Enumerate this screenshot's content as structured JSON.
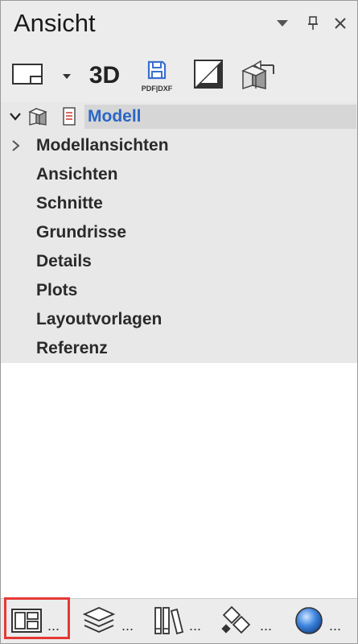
{
  "panel": {
    "title": "Ansicht"
  },
  "title_controls": {
    "dropdown_icon": "triangle-down-icon",
    "pin_icon": "pin-icon",
    "close_icon": "close-icon"
  },
  "toolbar": {
    "viewport_icon": "viewport-frame-icon",
    "viewport_dropdown_icon": "triangle-down-icon",
    "three_d_label": "3D",
    "pdf_caption": "PDF|DXF",
    "pdf_icon": "save-disk-icon",
    "elevation_icon": "diagonal-split-icon",
    "import_icon": "box-import-icon"
  },
  "tree": {
    "root": {
      "label": "Modell",
      "icons": [
        "cube-icon",
        "document-icon"
      ]
    },
    "items": [
      {
        "label": "Modellansichten",
        "expandable": true
      },
      {
        "label": "Ansichten",
        "expandable": false
      },
      {
        "label": "Schnitte",
        "expandable": false
      },
      {
        "label": "Grundrisse",
        "expandable": false
      },
      {
        "label": "Details",
        "expandable": false
      },
      {
        "label": "Plots",
        "expandable": false
      },
      {
        "label": "Layoutvorlagen",
        "expandable": false
      },
      {
        "label": "Referenz",
        "expandable": false
      }
    ]
  },
  "bottombar": {
    "items": [
      {
        "icon": "layout-panels-icon",
        "more": "..."
      },
      {
        "icon": "layers-icon",
        "more": "..."
      },
      {
        "icon": "library-books-icon",
        "more": "..."
      },
      {
        "icon": "tools-icon",
        "more": "..."
      },
      {
        "icon": "sphere-icon",
        "more": "..."
      }
    ]
  },
  "colors": {
    "accent": "#2a66c6",
    "highlight": "#e53935",
    "tree_bg": "#e8e8e8",
    "chrome_bg": "#ececec"
  }
}
